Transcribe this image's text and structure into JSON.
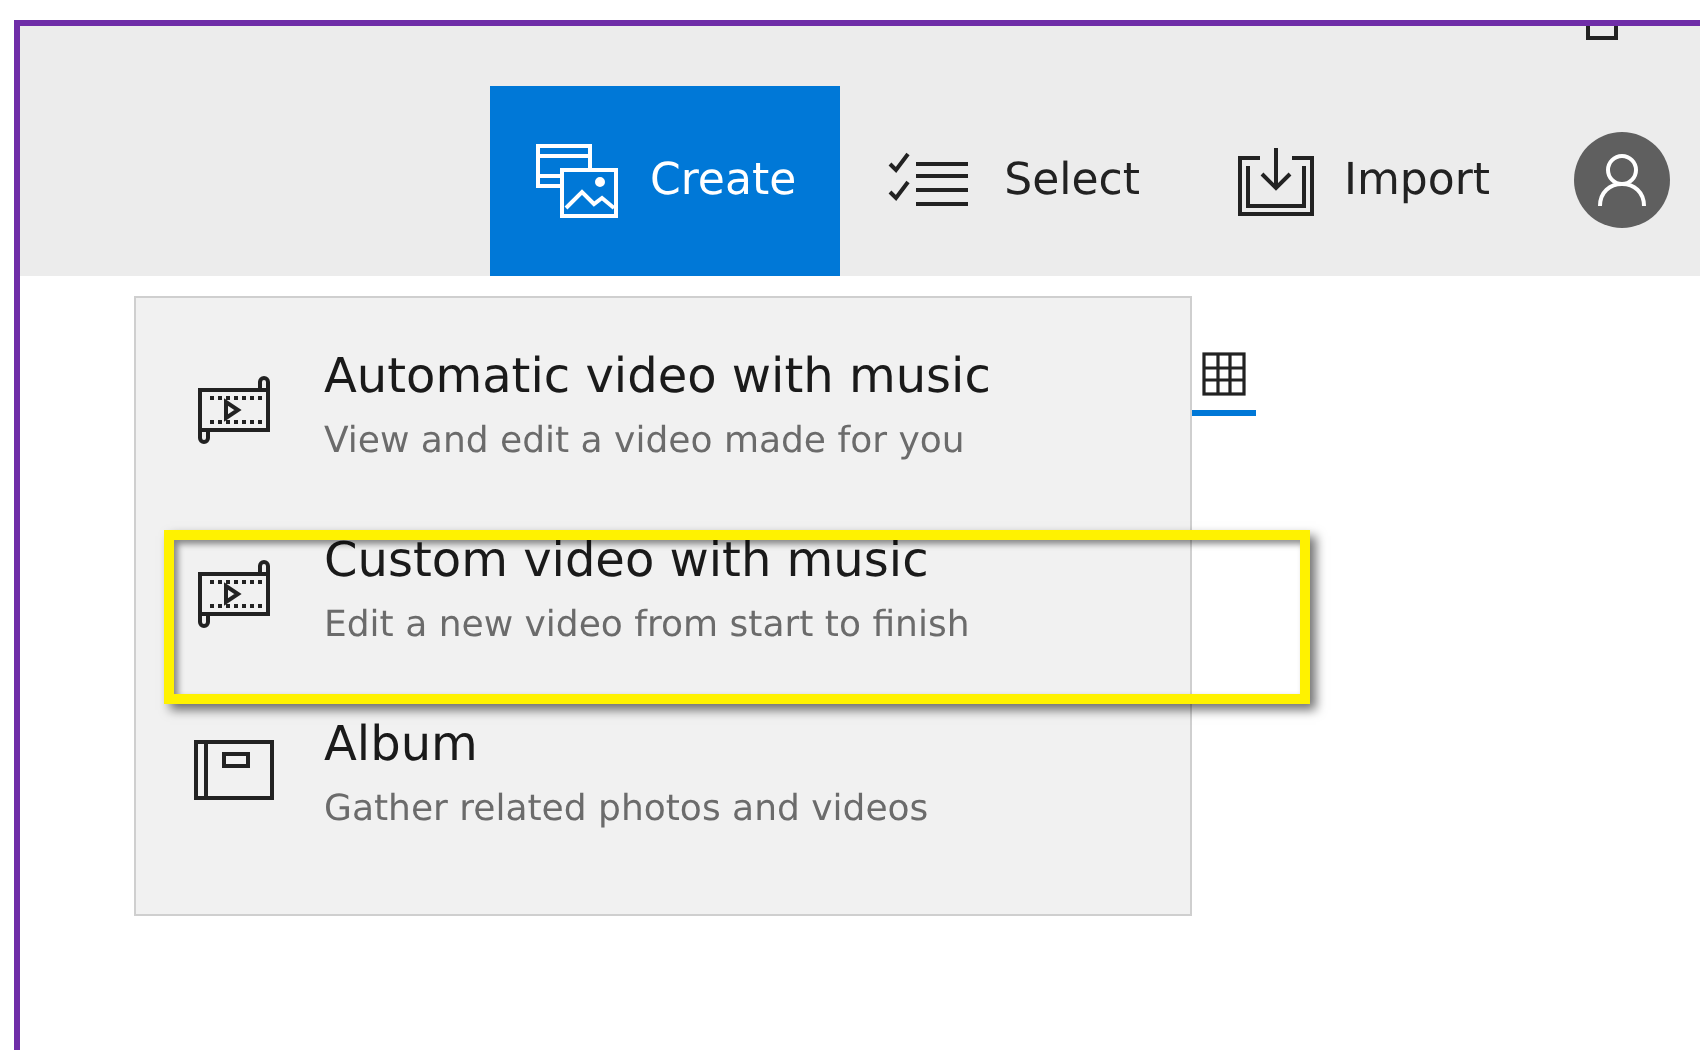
{
  "toolbar": {
    "buttons": [
      {
        "kind": "create",
        "label": "Create",
        "selected": true
      },
      {
        "kind": "select",
        "label": "Select",
        "selected": false
      },
      {
        "kind": "import",
        "label": "Import",
        "selected": false
      }
    ]
  },
  "view_tabs": [
    {
      "kind": "grid",
      "selected": true
    }
  ],
  "create_menu": {
    "items": [
      {
        "kind": "video",
        "title": "Automatic video with music",
        "subtitle": "View and edit a video made for you",
        "highlighted": false
      },
      {
        "kind": "video",
        "title": "Custom video with music",
        "subtitle": "Edit a new video from start to finish",
        "highlighted": true
      },
      {
        "kind": "album",
        "title": "Album",
        "subtitle": "Gather related photos and videos",
        "highlighted": false
      }
    ]
  }
}
